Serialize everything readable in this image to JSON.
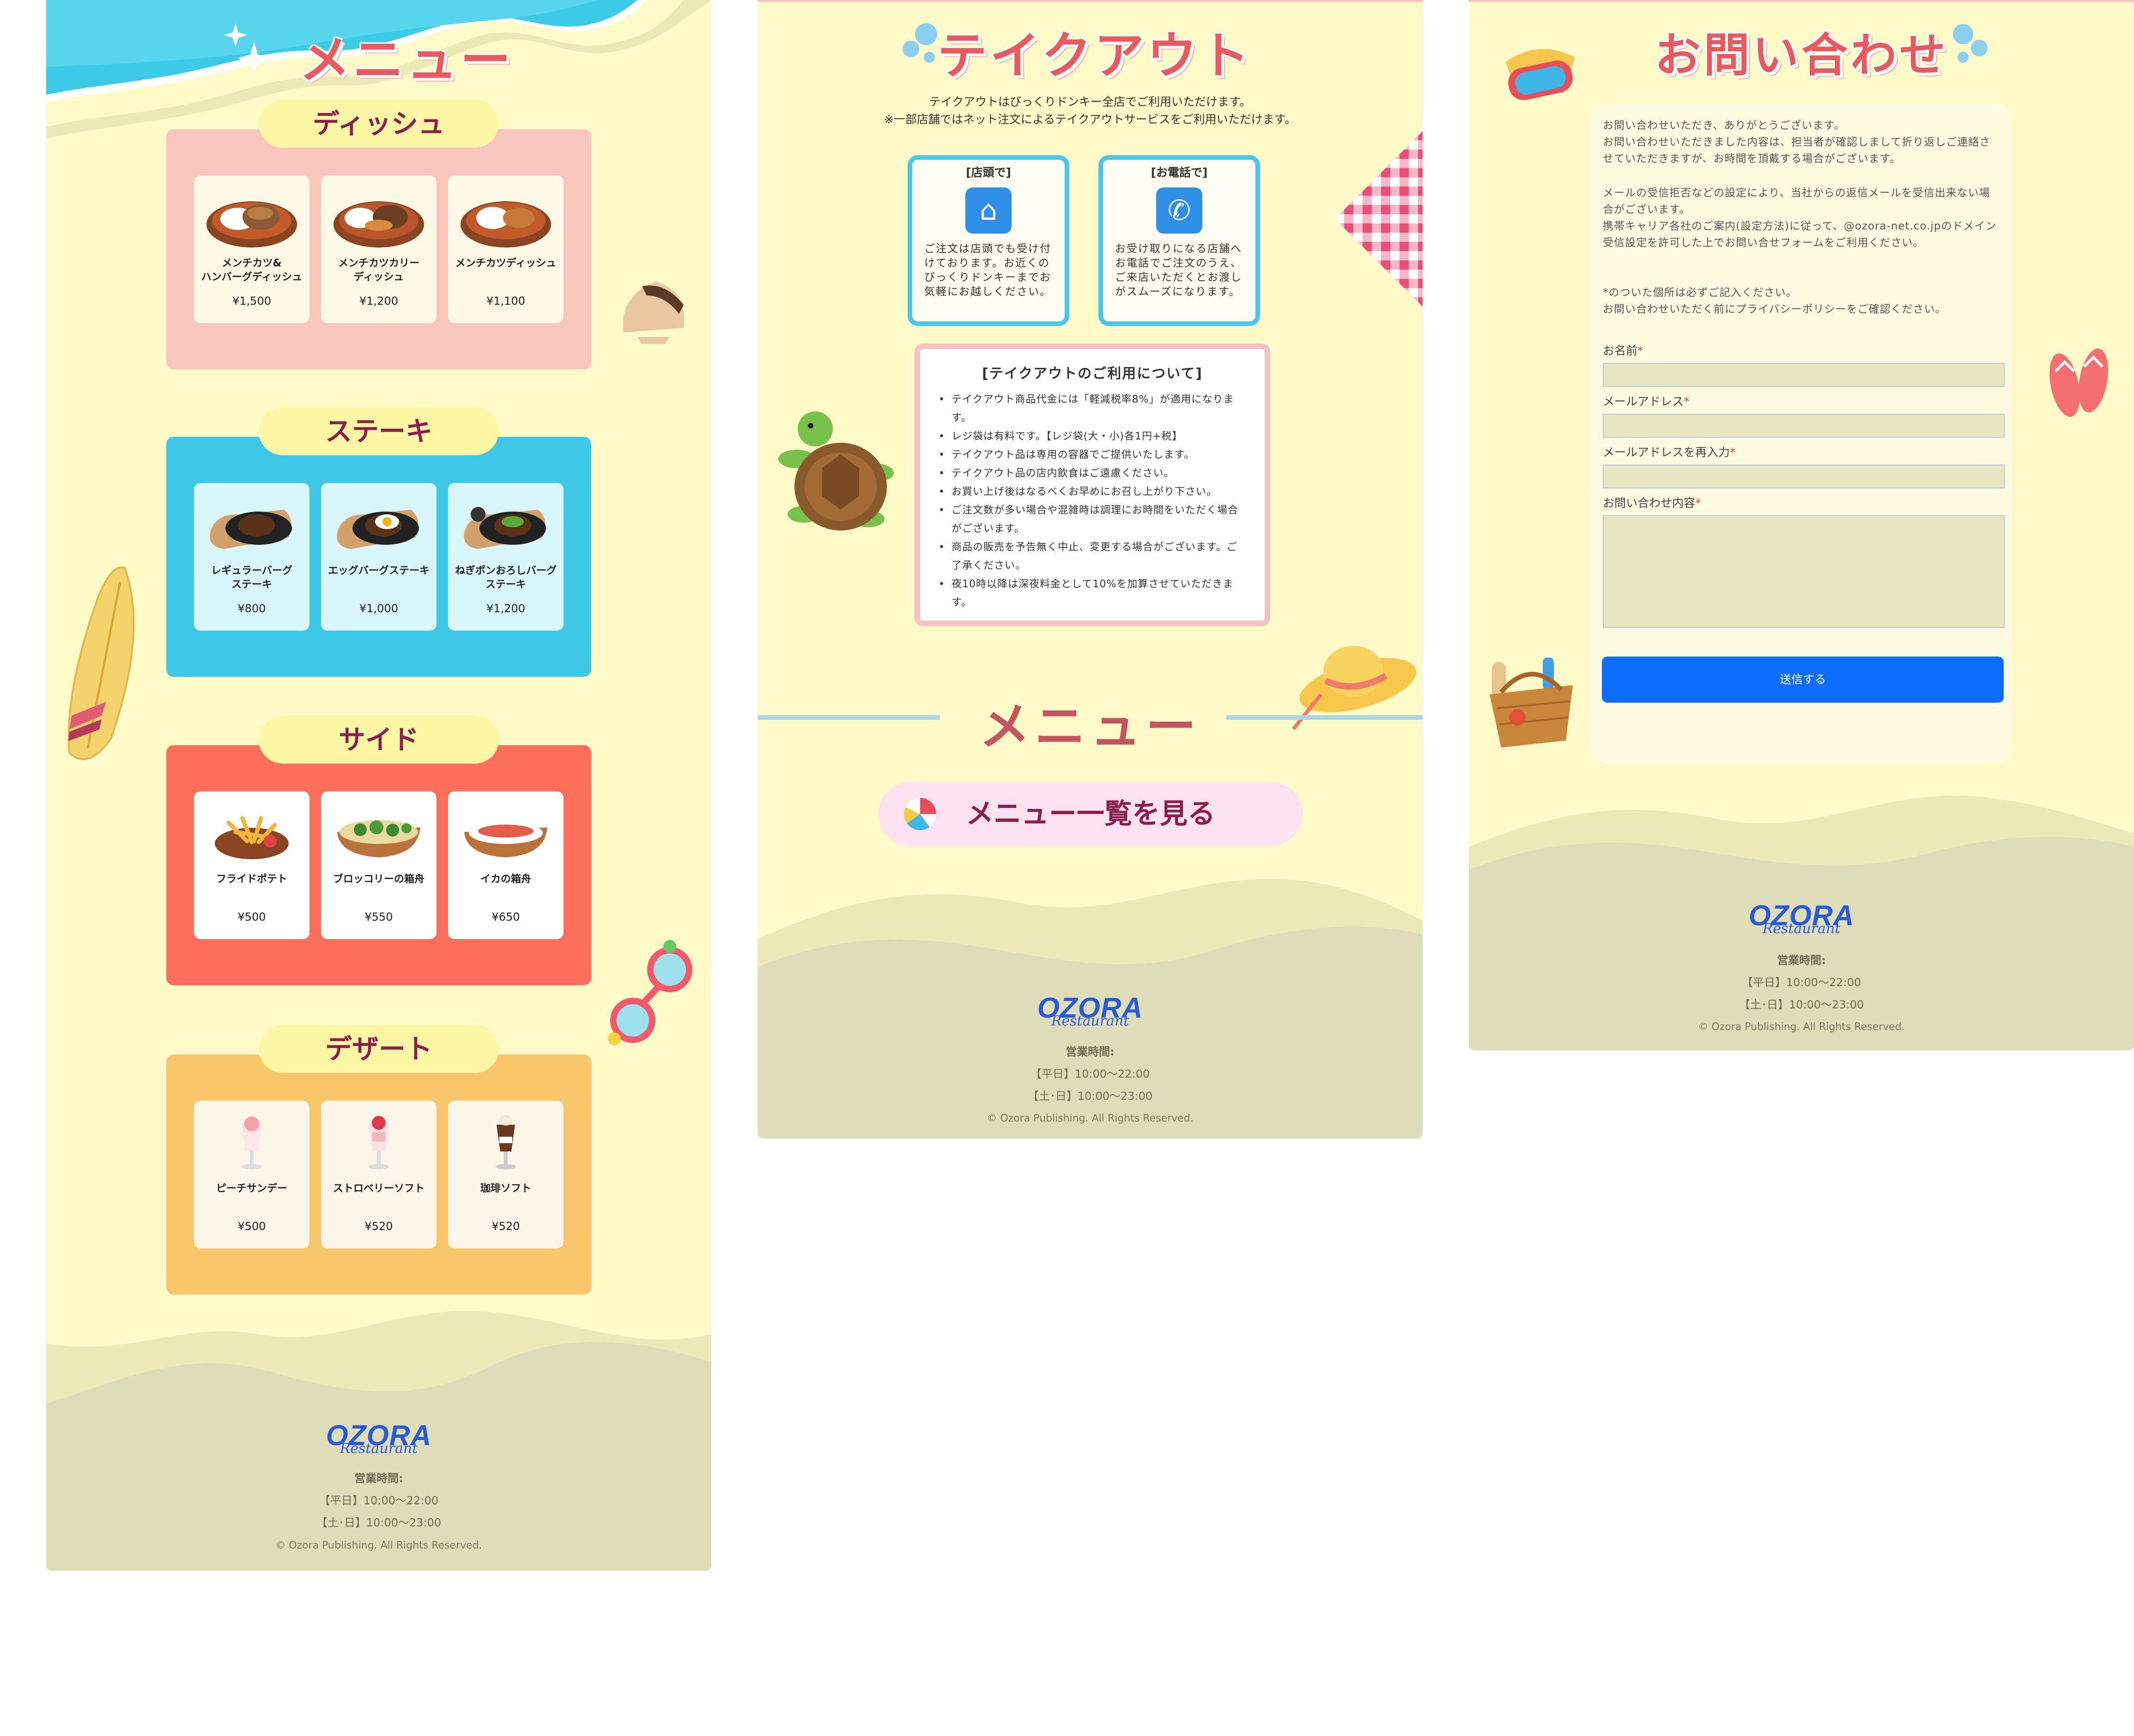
{
  "menu_page": {
    "title": "メニュー",
    "sections": [
      {
        "name": "ディッシュ",
        "items": [
          {
            "name": "メンチカツ&\nハンバーグディッシュ",
            "price": "¥1,500"
          },
          {
            "name": "メンチカツカリー\nディッシュ",
            "price": "¥1,200"
          },
          {
            "name": "メンチカツディッシュ",
            "price": "¥1,100"
          }
        ]
      },
      {
        "name": "ステーキ",
        "items": [
          {
            "name": "レギュラーバーグ\nステーキ",
            "price": "¥800"
          },
          {
            "name": "エッグバーグステーキ",
            "price": "¥1,000"
          },
          {
            "name": "ねぎポンおろしバーグ\nステーキ",
            "price": "¥1,200"
          }
        ]
      },
      {
        "name": "サイド",
        "items": [
          {
            "name": "フライドポテト",
            "price": "¥500"
          },
          {
            "name": "ブロッコリーの箱舟",
            "price": "¥550"
          },
          {
            "name": "イカの箱舟",
            "price": "¥650"
          }
        ]
      },
      {
        "name": "デザート",
        "items": [
          {
            "name": "ピーチサンデー",
            "price": "¥500"
          },
          {
            "name": "ストロベリーソフト",
            "price": "¥520"
          },
          {
            "name": "珈琲ソフト",
            "price": "¥520"
          }
        ]
      }
    ]
  },
  "takeout_page": {
    "title": "テイクアウト",
    "intro_1": "テイクアウトはびっくりドンキー全店でご利用いただけます。",
    "intro_2": "※一部店舗ではネット注文によるテイクアウトサービスをご利用いただけます。",
    "store": {
      "title": "[店頭で]",
      "text": "ご注文は店頭でも受け付けております。お近くのびっくりドンキーまでお気軽にお越しください。"
    },
    "phone": {
      "title": "[お電話で]",
      "text": "お受け取りになる店舗へお電話でご注文のうえ、ご来店いただくとお渡しがスムーズになります。"
    },
    "rules_title": "[テイクアウトのご利用について]",
    "rules": [
      "テイクアウト商品代金には「軽減税率8%」が適用になります。",
      "レジ袋は有料です。【レジ袋(大・小)各1円+税】",
      "テイクアウト品は専用の容器でご提供いたします。",
      "テイクアウト品の店内飲食はご遠慮ください。",
      "お買い上げ後はなるべくお早めにお召し上がり下さい。",
      "ご注文数が多い場合や混雑時は調理にお時間をいただく場合がございます。",
      "商品の販売を予告無く中止、変更する場合がございます。ご了承ください。",
      "夜10時以降は深夜料金として10%を加算させていただきます。"
    ],
    "menu_heading": "メニュー",
    "menu_button": "メニュー一覧を見る"
  },
  "contact_page": {
    "title": "お問い合わせ",
    "p1": "お問い合わせいただき、ありがとうございます。\nお問い合わせいただきました内容は、担当者が確認しまして折り返しご連絡させていただきますが、お時間を頂戴する場合がございます。",
    "p2": "メールの受信拒否などの設定により、当社からの返信メールを受信出来ない場合がございます。\n携帯キャリア各社のご案内(設定方法)に従って、@ozora-net.co.jpのドメイン受信設定を許可した上でお問い合せフォームをご利用ください。",
    "p3": "*のついた個所は必ずご記入ください。\nお問い合わせいただく前にプライバシーポリシーをご確認ください。",
    "fields": [
      "お名前",
      "メールアドレス",
      "メールアドレスを再入力",
      "お問い合わせ内容"
    ],
    "required_mark": "*",
    "submit": "送信する"
  },
  "footer": {
    "logo_top": "OZORA",
    "logo_bottom": "Restaurant",
    "hours_title": "営業時間:",
    "weekday": "【平日】10:00〜22:00",
    "weekend": "【土･日】10:00〜23:00",
    "copyright": "© Ozora Publishing. All Rights Reserved."
  },
  "colors": {
    "dish_bg": "#f9c6bf",
    "steak_bg": "#3fc8e6",
    "side_bg": "#fd6f5a",
    "dessert_bg": "#f9c66b",
    "cream": "#fffac8",
    "sand": "#dfdcb9",
    "accent_blue": "#0d6efd"
  }
}
